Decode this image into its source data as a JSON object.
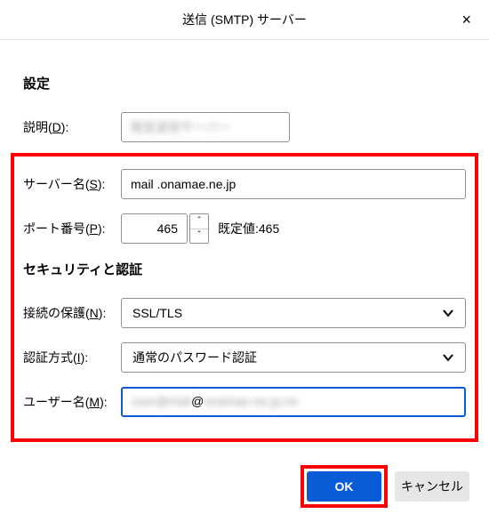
{
  "dialog": {
    "title": "送信 (SMTP) サーバー",
    "close_icon": "×"
  },
  "sections": {
    "settings_title": "設定",
    "security_title": "セキュリティと認証"
  },
  "fields": {
    "description": {
      "label_pre": "説明(",
      "mnemonic": "D",
      "label_post": "):",
      "value": ""
    },
    "server": {
      "label_pre": "サーバー名(",
      "mnemonic": "S",
      "label_post": "):",
      "value": "mail .onamae.ne.jp"
    },
    "port": {
      "label_pre": "ポート番号(",
      "mnemonic": "P",
      "label_post": "):",
      "value": "465",
      "default_label": "既定値:",
      "default_value": "465"
    },
    "security": {
      "label_pre": "接続の保護(",
      "mnemonic": "N",
      "label_post": "):",
      "value": "SSL/TLS"
    },
    "auth": {
      "label_pre": "認証方式(",
      "mnemonic": "I",
      "label_post": "):",
      "value": "通常のパスワード認証"
    },
    "username": {
      "label_pre": "ユーザー名(",
      "mnemonic": "M",
      "label_post": "):",
      "value_visible": "@"
    }
  },
  "buttons": {
    "ok": "OK",
    "cancel": "キャンセル"
  }
}
